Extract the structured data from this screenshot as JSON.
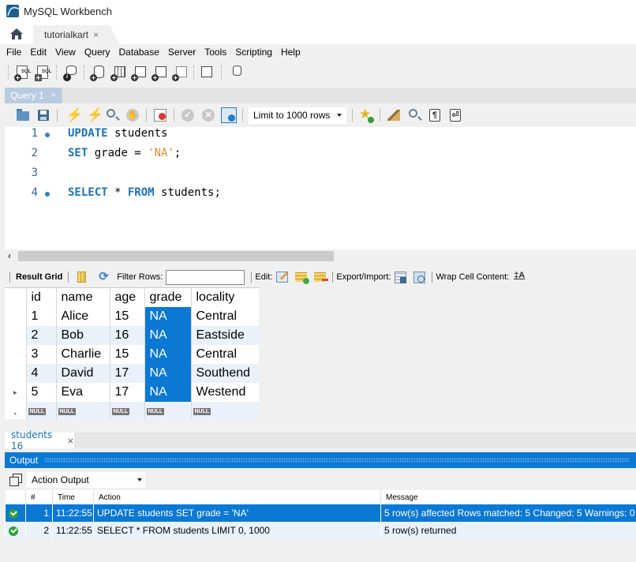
{
  "window": {
    "title": "MySQL Workbench"
  },
  "connection_tabs": {
    "home_icon": "home-icon",
    "active": {
      "label": "tutorialkart",
      "close": "×"
    }
  },
  "menu": [
    "File",
    "Edit",
    "View",
    "Query",
    "Database",
    "Server",
    "Tools",
    "Scripting",
    "Help"
  ],
  "main_toolbar": {
    "icons": [
      "new-sql-tab-icon",
      "open-sql-script-icon",
      "schema-inspector-icon",
      "create-schema-icon",
      "create-table-icon",
      "create-view-icon",
      "create-procedure-icon",
      "create-function-icon",
      "search-table-data-icon",
      "reconnect-icon"
    ],
    "sql_label": "SQL"
  },
  "query_tab": {
    "label": "Query 1",
    "close": "×"
  },
  "sql_toolbar": {
    "limit_select": "Limit to 1000 rows",
    "icons": [
      "open-file-icon",
      "save-icon",
      "execute-icon",
      "execute-current-icon",
      "explain-icon",
      "stop-icon",
      "toggle-error-icon",
      "commit-icon",
      "rollback-icon",
      "autocommit-icon",
      "add-snippet-icon",
      "beautify-icon",
      "find-icon",
      "invisible-chars-icon",
      "wrap-lines-icon"
    ]
  },
  "editor": {
    "lines": [
      {
        "number": "1",
        "marker": true,
        "tokens": [
          {
            "t": "UPDATE",
            "c": "kw"
          },
          {
            "t": " students",
            "c": ""
          }
        ]
      },
      {
        "number": "2",
        "marker": false,
        "tokens": [
          {
            "t": "SET",
            "c": "kw"
          },
          {
            "t": " grade = ",
            "c": ""
          },
          {
            "t": "'NA'",
            "c": "str"
          },
          {
            "t": ";",
            "c": ""
          }
        ]
      },
      {
        "number": "3",
        "marker": false,
        "tokens": []
      },
      {
        "number": "4",
        "marker": true,
        "tokens": [
          {
            "t": "SELECT",
            "c": "kw"
          },
          {
            "t": " * ",
            "c": ""
          },
          {
            "t": "FROM",
            "c": "kw"
          },
          {
            "t": " students;",
            "c": ""
          }
        ]
      }
    ]
  },
  "scrollbar": {
    "left_arrow": "‹"
  },
  "result_toolbar": {
    "result_grid": "Result Grid",
    "filter_label": "Filter Rows:",
    "filter_value": "",
    "edit_label": "Edit:",
    "export_label": "Export/Import:",
    "wrap_label": "Wrap Cell Content:",
    "wrap_glyph": "‡A"
  },
  "grid": {
    "columns": [
      "id",
      "name",
      "age",
      "grade",
      "locality"
    ],
    "rows": [
      [
        "1",
        "Alice",
        "15",
        "NA",
        "Central"
      ],
      [
        "2",
        "Bob",
        "16",
        "NA",
        "Eastside"
      ],
      [
        "3",
        "Charlie",
        "15",
        "NA",
        "Central"
      ],
      [
        "4",
        "David",
        "17",
        "NA",
        "Southend"
      ],
      [
        "5",
        "Eva",
        "17",
        "NA",
        "Westend"
      ]
    ],
    "selected_column": "grade",
    "current_row_marker": "▸",
    "new_row_marker": "*",
    "null_label": "NULL"
  },
  "result_tab": {
    "label": "students 16",
    "close": "×"
  },
  "output": {
    "title": "Output",
    "select": "Action Output",
    "columns": [
      "",
      "#",
      "Time",
      "Action",
      "Message"
    ],
    "rows": [
      {
        "status": "success",
        "num": "1",
        "time": "11:22:55",
        "action": "UPDATE students SET grade = 'NA'",
        "message": "5 row(s) affected Rows matched: 5  Changed: 5  Warnings: 0"
      },
      {
        "status": "success",
        "num": "2",
        "time": "11:22:55",
        "action": "SELECT * FROM students LIMIT 0, 1000",
        "message": "5 row(s) returned"
      }
    ]
  },
  "colors": {
    "accent": "#0b78d4",
    "keyword": "#1a73b8",
    "string": "#e08b2c",
    "row_alt": "#eaf1fb",
    "success": "#2e9e3a"
  }
}
